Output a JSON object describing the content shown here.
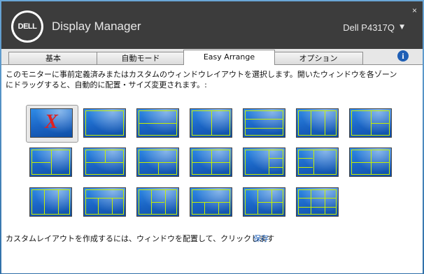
{
  "window": {
    "logo_text": "DELL",
    "title": "Display Manager",
    "monitor": "Dell P4317Q",
    "close_glyph": "×"
  },
  "tabs": [
    {
      "label": "基本",
      "active": false
    },
    {
      "label": "自動モード",
      "active": false
    },
    {
      "label": "Easy Arrange",
      "active": true
    },
    {
      "label": "オプション",
      "active": false
    }
  ],
  "info_icon": "info-icon",
  "description": "このモニターに事前定義済みまたはカスタムのウィンドウレイアウトを選択します。開いたウィンドウを各ゾーンにドラッグすると、自動的に配置・サイズ変更されます。:",
  "custom_layout_mark": "X",
  "footer": {
    "text": "カスタムレイアウトを作成するには、ウィンドウを配置して、クリックします",
    "save_label": "保存"
  },
  "colors": {
    "titlebar": "#3c3c3c",
    "zone_line": "#c8f000",
    "tile_blue": "#1b6fd1",
    "link": "#1f5fb5",
    "custom_x": "#e02020"
  }
}
